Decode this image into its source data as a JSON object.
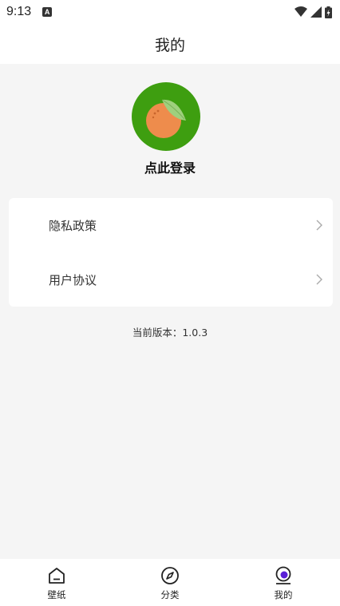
{
  "status_bar": {
    "time": "9:13",
    "notification_icon": "a-notification-icon",
    "icons": [
      "wifi-icon",
      "signal-icon",
      "battery-charging-icon"
    ]
  },
  "header": {
    "title": "我的"
  },
  "profile": {
    "avatar_icon": "orange-fruit-icon",
    "login_label": "点此登录"
  },
  "menu": {
    "items": [
      {
        "label": "隐私政策",
        "icon": "chevron-right-icon"
      },
      {
        "label": "用户协议",
        "icon": "chevron-right-icon"
      }
    ]
  },
  "version_label": "当前版本：1.0.3",
  "bottom_nav": {
    "items": [
      {
        "label": "壁纸",
        "icon": "home-icon",
        "active": false
      },
      {
        "label": "分类",
        "icon": "compass-icon",
        "active": false
      },
      {
        "label": "我的",
        "icon": "profile-icon",
        "active": true
      }
    ]
  },
  "colors": {
    "avatar_bg": "#3e9e10",
    "page_bg": "#f5f5f5",
    "active_accent": "#5a1fd6"
  }
}
